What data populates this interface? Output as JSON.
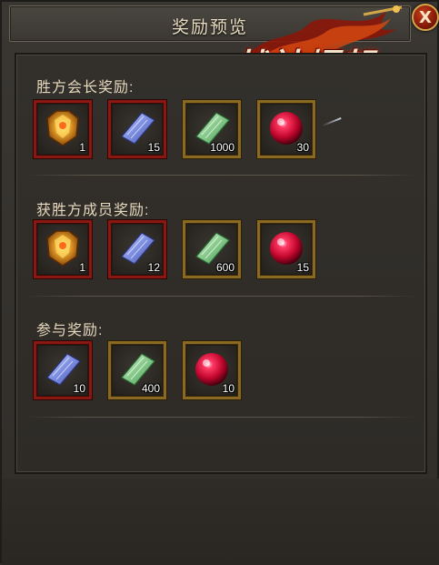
{
  "dialog": {
    "title": "奖励预览",
    "close_label": "X",
    "logo_text": "战神崛起"
  },
  "sections": [
    {
      "title": "胜方会长奖励:",
      "items": [
        {
          "icon": "golden-armor-icon",
          "qty": "1",
          "frame": "red"
        },
        {
          "icon": "blue-scroll-icon",
          "qty": "15",
          "frame": "red"
        },
        {
          "icon": "green-scroll-icon",
          "qty": "1000",
          "frame": "gold"
        },
        {
          "icon": "red-orb-icon",
          "qty": "30",
          "frame": "gold"
        }
      ]
    },
    {
      "title": "获胜方成员奖励:",
      "items": [
        {
          "icon": "golden-armor-icon",
          "qty": "1",
          "frame": "red"
        },
        {
          "icon": "blue-scroll-icon",
          "qty": "12",
          "frame": "red"
        },
        {
          "icon": "green-scroll-icon",
          "qty": "600",
          "frame": "gold"
        },
        {
          "icon": "red-orb-icon",
          "qty": "15",
          "frame": "gold"
        }
      ]
    },
    {
      "title": "参与奖励:",
      "items": [
        {
          "icon": "blue-scroll-icon",
          "qty": "10",
          "frame": "red"
        },
        {
          "icon": "green-scroll-icon",
          "qty": "400",
          "frame": "gold"
        },
        {
          "icon": "red-orb-icon",
          "qty": "10",
          "frame": "gold"
        }
      ]
    }
  ],
  "colors": {
    "red_frame": "#8a1812",
    "gold_frame": "#8a6a22",
    "title_text": "#e8dcc0"
  }
}
